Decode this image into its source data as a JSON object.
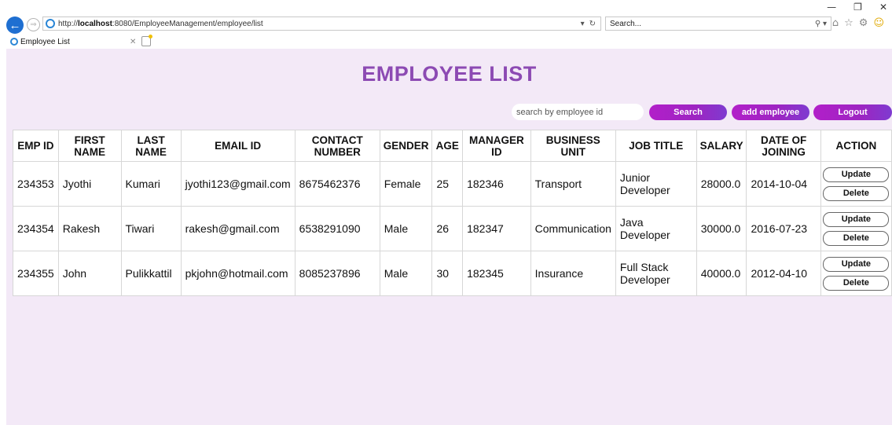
{
  "browser": {
    "url_prefix": "http://",
    "url_host": "localhost",
    "url_rest": ":8080/EmployeeManagement/employee/list",
    "search_placeholder": "Search...",
    "tab_title": "Employee List"
  },
  "page": {
    "title": "EMPLOYEE LIST",
    "search_placeholder": "search by employee id",
    "search_label": "Search",
    "add_label": "add employee",
    "logout_label": "Logout",
    "accent_color": "#8c4ab3",
    "background_color": "#f3e9f7"
  },
  "table": {
    "headers": [
      "EMP ID",
      "FIRST NAME",
      "LAST NAME",
      "EMAIL ID",
      "CONTACT NUMBER",
      "GENDER",
      "AGE",
      "MANAGER ID",
      "BUSINESS UNIT",
      "JOB TITLE",
      "SALARY",
      "DATE OF JOINING",
      "ACTION"
    ],
    "rows": [
      [
        "234353",
        "Jyothi",
        "Kumari",
        "jyothi123@gmail.com",
        "8675462376",
        "Female",
        "25",
        "182346",
        "Transport",
        "Junior Developer",
        "28000.0",
        "2014-10-04"
      ],
      [
        "234354",
        "Rakesh",
        "Tiwari",
        "rakesh@gmail.com",
        "6538291090",
        "Male",
        "26",
        "182347",
        "Communication",
        "Java Developer",
        "30000.0",
        "2016-07-23"
      ],
      [
        "234355",
        "John",
        "Pulikkattil",
        "pkjohn@hotmail.com",
        "8085237896",
        "Male",
        "30",
        "182345",
        "Insurance",
        "Full Stack Developer",
        "40000.0",
        "2012-04-10"
      ]
    ],
    "update_label": "Update",
    "delete_label": "Delete"
  }
}
